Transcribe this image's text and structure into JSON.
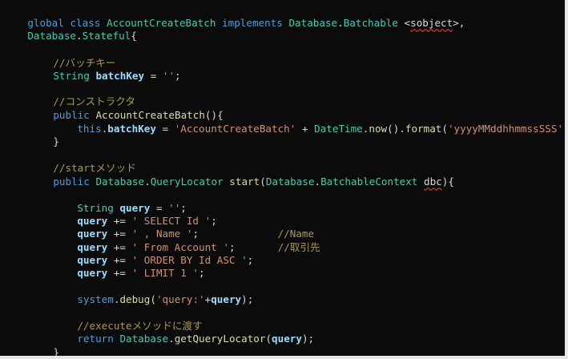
{
  "editor": {
    "lines": [
      "global class AccountCreateBatch implements Database.Batchable <sobject>,",
      "Database.Stateful{",
      "",
      "    //バッチキー",
      "    String batchKey = '';",
      "",
      "    //コンストラクタ",
      "    public AccountCreateBatch(){",
      "        this.batchKey = 'AccountCreateBatch' + DateTime.now().format('yyyyMMddhhmmssSSS');",
      "    }",
      "",
      "    //startメソッド",
      "    public Database.QueryLocator start(Database.BatchableContext dbc){",
      "",
      "        String query = '';",
      "        query += ' SELECT Id ';",
      "        query += ' , Name ';             //Name",
      "        query += ' From Account ';       //取引先",
      "        query += ' ORDER BY Id ASC ';",
      "        query += ' LIMIT 1 ';",
      "",
      "        system.debug('query:'+query);",
      "",
      "        //executeメソッドに渡す",
      "        return Database.getQueryLocator(query);",
      "    }"
    ]
  }
}
